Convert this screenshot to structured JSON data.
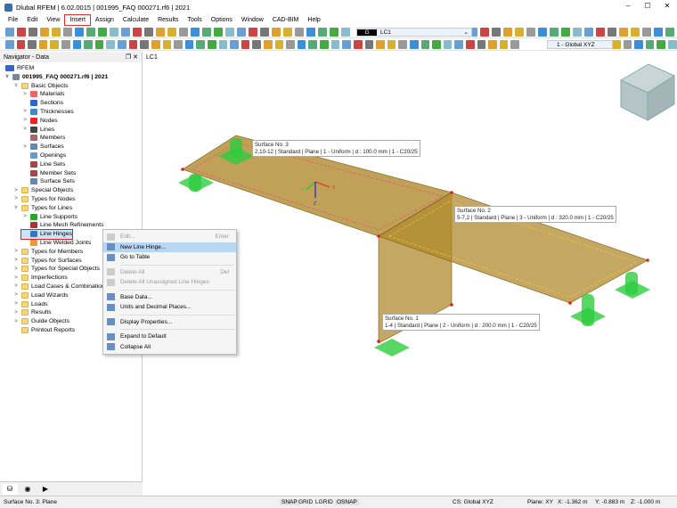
{
  "window": {
    "title": "Dlubal RFEM | 6.02.0015 | 001995_FAQ 000271.rf6 | 2021",
    "min": "–",
    "max": "☐",
    "close": "✕"
  },
  "menu": [
    "File",
    "Edit",
    "View",
    "Insert",
    "Assign",
    "Calculate",
    "Results",
    "Tools",
    "Options",
    "Window",
    "CAD-BIM",
    "Help"
  ],
  "toolbar": {
    "load_case_tag": "G",
    "load_case": "LC1",
    "coord_system": "1 - Global XYZ"
  },
  "navigator": {
    "title": "Navigator - Data",
    "root": "RFEM",
    "file": "001995_FAQ 000271.rf6 | 2021",
    "items": [
      {
        "label": "Basic Objects",
        "level": 1,
        "exp": "v",
        "icon": "folder"
      },
      {
        "label": "Materials",
        "level": 2,
        "exp": ">",
        "icon": "materials"
      },
      {
        "label": "Sections",
        "level": 2,
        "exp": "",
        "icon": "sections"
      },
      {
        "label": "Thicknesses",
        "level": 2,
        "exp": ">",
        "icon": "thicknesses"
      },
      {
        "label": "Nodes",
        "level": 2,
        "exp": ">",
        "icon": "nodes"
      },
      {
        "label": "Lines",
        "level": 2,
        "exp": ">",
        "icon": "lines"
      },
      {
        "label": "Members",
        "level": 2,
        "exp": "",
        "icon": "members"
      },
      {
        "label": "Surfaces",
        "level": 2,
        "exp": ">",
        "icon": "surfaces"
      },
      {
        "label": "Openings",
        "level": 2,
        "exp": "",
        "icon": "openings"
      },
      {
        "label": "Line Sets",
        "level": 2,
        "exp": "",
        "icon": "line-sets"
      },
      {
        "label": "Member Sets",
        "level": 2,
        "exp": "",
        "icon": "member-sets"
      },
      {
        "label": "Surface Sets",
        "level": 2,
        "exp": "",
        "icon": "surface-sets"
      },
      {
        "label": "Special Objects",
        "level": 1,
        "exp": ">",
        "icon": "folder"
      },
      {
        "label": "Types for Nodes",
        "level": 1,
        "exp": ">",
        "icon": "folder"
      },
      {
        "label": "Types for Lines",
        "level": 1,
        "exp": "v",
        "icon": "folder"
      },
      {
        "label": "Line Supports",
        "level": 2,
        "exp": ">",
        "icon": "line-supports"
      },
      {
        "label": "Line Mesh Refinements",
        "level": 2,
        "exp": "",
        "icon": "line-mesh"
      },
      {
        "label": "Line Hinges",
        "level": 2,
        "exp": "",
        "icon": "line-hinges",
        "selected": true
      },
      {
        "label": "Line Welded Joints",
        "level": 2,
        "exp": "",
        "icon": "welded"
      },
      {
        "label": "Types for Members",
        "level": 1,
        "exp": ">",
        "icon": "folder"
      },
      {
        "label": "Types for Surfaces",
        "level": 1,
        "exp": ">",
        "icon": "folder"
      },
      {
        "label": "Types for Special Objects",
        "level": 1,
        "exp": ">",
        "icon": "folder"
      },
      {
        "label": "Imperfections",
        "level": 1,
        "exp": ">",
        "icon": "folder"
      },
      {
        "label": "Load Cases & Combinations",
        "level": 1,
        "exp": ">",
        "icon": "folder"
      },
      {
        "label": "Load Wizards",
        "level": 1,
        "exp": ">",
        "icon": "folder"
      },
      {
        "label": "Loads",
        "level": 1,
        "exp": ">",
        "icon": "folder"
      },
      {
        "label": "Results",
        "level": 1,
        "exp": ">",
        "icon": "folder"
      },
      {
        "label": "Guide Objects",
        "level": 1,
        "exp": ">",
        "icon": "folder"
      },
      {
        "label": "Printout Reports",
        "level": 1,
        "exp": "",
        "icon": "folder"
      }
    ]
  },
  "context_menu": [
    {
      "label": "Edit...",
      "shortcut": "Enter",
      "disabled": true
    },
    {
      "label": "New Line Hinge...",
      "highlighted": true
    },
    {
      "label": "Go to Table"
    },
    {
      "sep": true
    },
    {
      "label": "Delete All",
      "shortcut": "Del",
      "disabled": true
    },
    {
      "label": "Delete All Unassigned Line Hinges",
      "disabled": true
    },
    {
      "sep": true
    },
    {
      "label": "Base Data..."
    },
    {
      "label": "Units and Decimal Places..."
    },
    {
      "sep": true
    },
    {
      "label": "Display Properties..."
    },
    {
      "sep": true
    },
    {
      "label": "Expand to Default"
    },
    {
      "label": "Collapse All"
    }
  ],
  "viewport": {
    "lc_label": "LC1",
    "axes": {
      "x": "X",
      "y": "Y",
      "z": "Z"
    },
    "surfaces": [
      {
        "title": "Surface No. 3",
        "desc": "2,10-12 | Standard | Plane | 1 - Uniform | d : 100.0 mm | 1 - C20/25"
      },
      {
        "title": "Surface No. 2",
        "desc": "5-7,2 | Standard | Plane | 3 - Uniform | d : 320.0 mm | 1 - C20/25"
      },
      {
        "title": "Surface No. 1",
        "desc": "1-4 | Standard | Plane | 2 - Uniform | d : 200.0 mm | 1 - C20/25"
      }
    ]
  },
  "status": {
    "left": "Surface No. 3: Plane",
    "snap": "SNAP",
    "grid": "GRID",
    "lgrid": "LGRID",
    "osnap": "OSNAP",
    "cs": "CS: Global XYZ",
    "plane": "Plane: XY",
    "x": "X: -1.362 m",
    "y": "Y: -0.883 m",
    "z": "Z: -1.000 m"
  },
  "colors": {
    "surface": "#b08a2e",
    "support": "#2ecc40",
    "node": "#e02020",
    "select": "#cce4f7"
  }
}
